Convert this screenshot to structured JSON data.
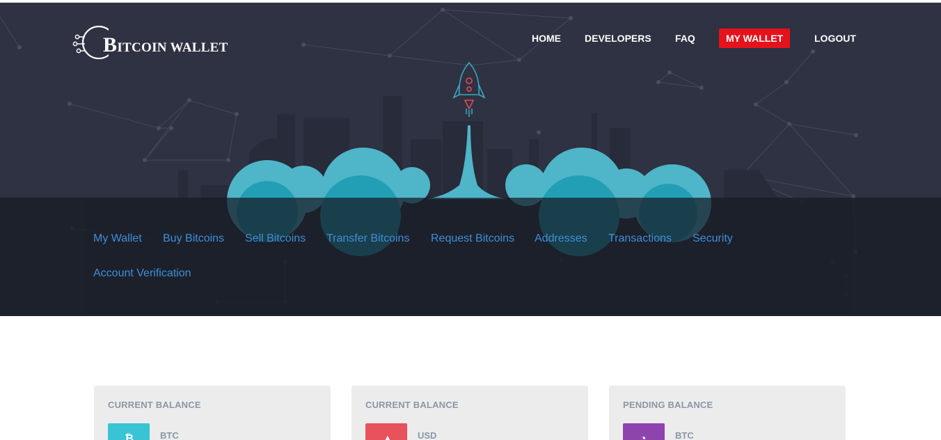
{
  "header": {
    "logo_letter": "B",
    "logo_text": "ITCOIN WALLET",
    "nav": [
      {
        "label": "HOME"
      },
      {
        "label": "DEVELOPERS"
      },
      {
        "label": "FAQ"
      },
      {
        "label": "MY WALLET",
        "active": true
      },
      {
        "label": "LOGOUT"
      }
    ]
  },
  "subnav": {
    "items": [
      {
        "label": "My Wallet"
      },
      {
        "label": "Buy Bitcoins"
      },
      {
        "label": "Sell Bitcoins"
      },
      {
        "label": "Transfer Bitcoins"
      },
      {
        "label": "Request Bitcoins"
      },
      {
        "label": "Addresses"
      },
      {
        "label": "Transactions"
      },
      {
        "label": "Security"
      },
      {
        "label": "Account Verification"
      }
    ]
  },
  "cards": [
    {
      "title": "CURRENT BALANCE",
      "unit": "BTC",
      "icon": "bitcoin-icon",
      "color": "#38c4d5"
    },
    {
      "title": "CURRENT BALANCE",
      "unit": "USD",
      "icon": "dollar-icon",
      "color": "#e8525c"
    },
    {
      "title": "PENDING BALANCE",
      "unit": "BTC",
      "icon": "clock-icon",
      "color": "#8e44ad"
    }
  ],
  "colors": {
    "hero_bg": "#2f3242",
    "accent_red": "#e5121c",
    "link_blue": "#3d8fd8",
    "cloud": "#4fb5c8"
  }
}
